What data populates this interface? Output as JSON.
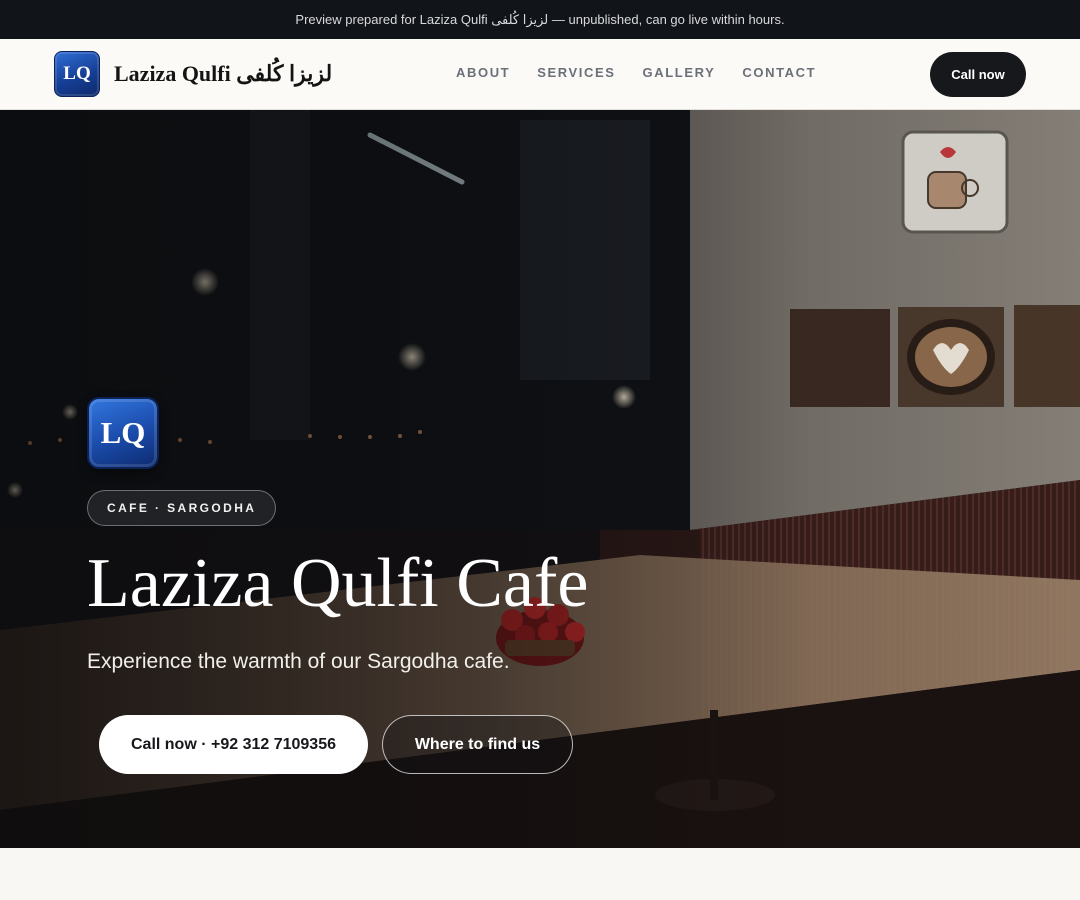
{
  "preview_banner": {
    "text": "Preview prepared for Laziza Qulfi لزیزا کُلفی — unpublished, can go live within hours."
  },
  "header": {
    "logo_initials": "LQ",
    "brand_name": "Laziza Qulfi لزیزا کُلفی",
    "nav": [
      {
        "label": "ABOUT"
      },
      {
        "label": "SERVICES"
      },
      {
        "label": "GALLERY"
      },
      {
        "label": "CONTACT"
      }
    ],
    "cta_label": "Call now"
  },
  "hero": {
    "logo_initials": "LQ",
    "category_badge": "CAFE · SARGODHA",
    "title": "Laziza Qulfi Cafe",
    "tagline": "Experience the warmth of our Sargodha cafe.",
    "primary_button": "Call now · +92 312 7109356",
    "secondary_button": "Where to find us",
    "background_image": "dimly lit cafe interior with wooden counter, red flowers, coffee art frames and a mug sign"
  },
  "colors": {
    "banner_bg": "#111418",
    "header_bg": "#fbfaf7",
    "dark_button": "#16181c",
    "logo_blue": "#1a4aa8",
    "page_bg": "#f8f7f3"
  }
}
